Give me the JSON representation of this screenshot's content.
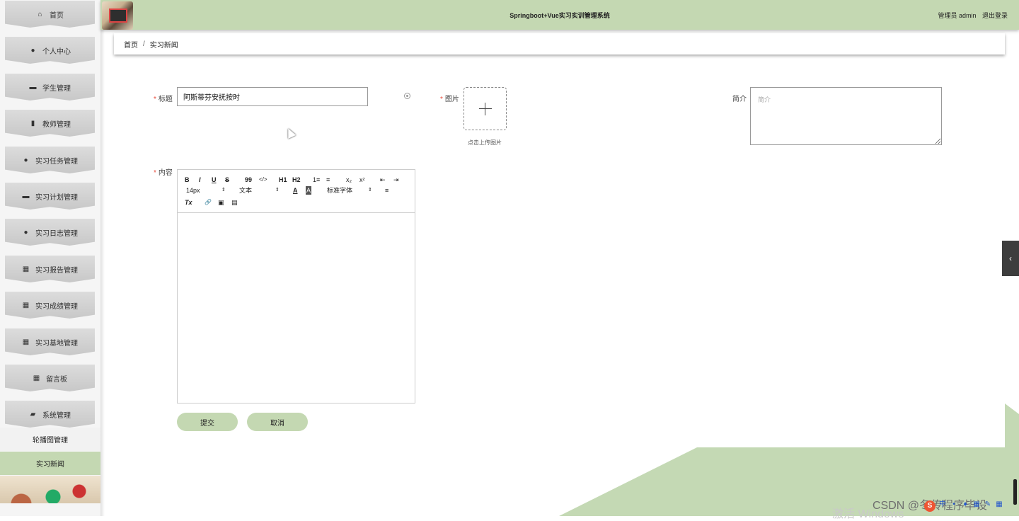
{
  "header": {
    "app_title": "Springboot+Vue实习实训管理系统",
    "user_label": "管理员 admin",
    "logout_label": "退出登录"
  },
  "sidebar": {
    "items": [
      {
        "label": "首页",
        "icon": "home-icon",
        "glyph": "⌂"
      },
      {
        "label": "个人中心",
        "icon": "user-icon",
        "glyph": "●"
      },
      {
        "label": "学生管理",
        "icon": "briefcase-icon",
        "glyph": "▬"
      },
      {
        "label": "教师管理",
        "icon": "clipboard-icon",
        "glyph": "▮"
      },
      {
        "label": "实习任务管理",
        "icon": "person-icon",
        "glyph": "●"
      },
      {
        "label": "实习计划管理",
        "icon": "monitor-icon",
        "glyph": "▬"
      },
      {
        "label": "实习日志管理",
        "icon": "location-icon",
        "glyph": "●"
      },
      {
        "label": "实习报告管理",
        "icon": "grid-icon",
        "glyph": "▦"
      },
      {
        "label": "实习成绩管理",
        "icon": "grid-icon",
        "glyph": "▦"
      },
      {
        "label": "实习基地管理",
        "icon": "grid-nine-icon",
        "glyph": "▦"
      },
      {
        "label": "留言板",
        "icon": "grid-icon",
        "glyph": "▦"
      },
      {
        "label": "系统管理",
        "icon": "chart-icon",
        "glyph": "▰"
      }
    ],
    "sub_items": [
      {
        "label": "轮播图管理"
      },
      {
        "label": "实习新闻"
      }
    ]
  },
  "breadcrumb": {
    "home": "首页",
    "separator": "/",
    "current": "实习新闻"
  },
  "form": {
    "title_label": "标题",
    "title_value": "阿斯蒂芬安抚按时",
    "image_label": "图片",
    "upload_tip": "点击上传图片",
    "intro_label": "简介",
    "intro_placeholder": "简介",
    "content_label": "内容",
    "required_mark": "*",
    "submit_label": "提交",
    "cancel_label": "取消"
  },
  "editor": {
    "bold": "B",
    "italic": "I",
    "underline": "U",
    "strike": "S",
    "quote": "99",
    "code": "</>",
    "h1": "H1",
    "h2": "H2",
    "ordered_list": "1≡",
    "bullet_list": "≡",
    "subscript": "x₂",
    "superscript": "x²",
    "outdent": "⇤",
    "indent": "⇥",
    "font_size": "14px",
    "text_type": "文本",
    "font_family": "标准字体",
    "font_color": "A",
    "bg_color": "A",
    "align": "≡",
    "clear_format": "Tx",
    "link": "🔗",
    "image": "▣",
    "video": "▤"
  },
  "overlay": {
    "watermark": "CSDN @冬传程序毕设",
    "activate_text": "激活 Windows"
  },
  "colors": {
    "accent_green": "#c4d8b2",
    "required_red": "#e74c3c"
  }
}
